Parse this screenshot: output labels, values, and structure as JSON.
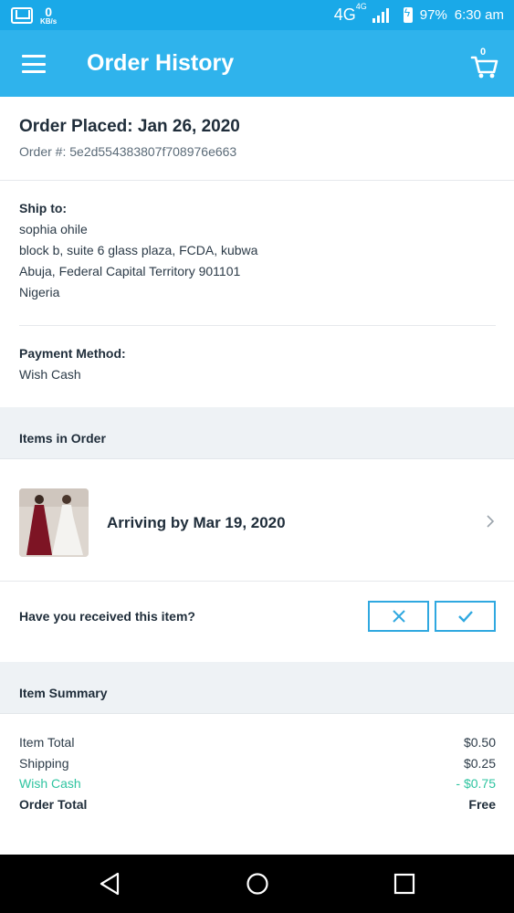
{
  "status_bar": {
    "speed_value": "0",
    "speed_unit": "KB/s",
    "network": "4G",
    "network_small": "4G",
    "battery": "97%",
    "time": "6:30 am"
  },
  "app_bar": {
    "title": "Order History",
    "cart_count": "0"
  },
  "order": {
    "placed": "Order Placed: Jan 26, 2020",
    "number": "Order #: 5e2d554383807f708976e663"
  },
  "ship_to": {
    "label": "Ship to:",
    "lines": [
      "sophia ohile",
      "block b, suite 6 glass plaza, FCDA, kubwa",
      "Abuja, Federal Capital Territory 901101",
      "Nigeria"
    ]
  },
  "payment": {
    "label": "Payment Method:",
    "method": "Wish Cash"
  },
  "items_section": {
    "label": "Items in Order",
    "items": [
      {
        "arrival": "Arriving by Mar 19, 2020"
      }
    ]
  },
  "received": {
    "question": "Have you received this item?"
  },
  "summary": {
    "label": "Item Summary",
    "rows": [
      {
        "label": "Item Total",
        "value": "$0.50"
      },
      {
        "label": "Shipping",
        "value": "$0.25"
      },
      {
        "label": "Wish Cash",
        "value": "- $0.75"
      },
      {
        "label": "Order Total",
        "value": "Free"
      }
    ]
  },
  "colors": {
    "app_bar": "#2fb3ec",
    "status_bar": "#1aa9e8",
    "accent": "#2fa8e0",
    "wish_cash": "#2ec4a0"
  },
  "icons": {
    "menu": "menu-icon",
    "cart": "cart-icon",
    "chevron": "chevron-right-icon",
    "reject": "close-icon",
    "confirm": "check-icon",
    "back": "back-icon",
    "home": "home-icon",
    "recents": "recents-icon"
  }
}
